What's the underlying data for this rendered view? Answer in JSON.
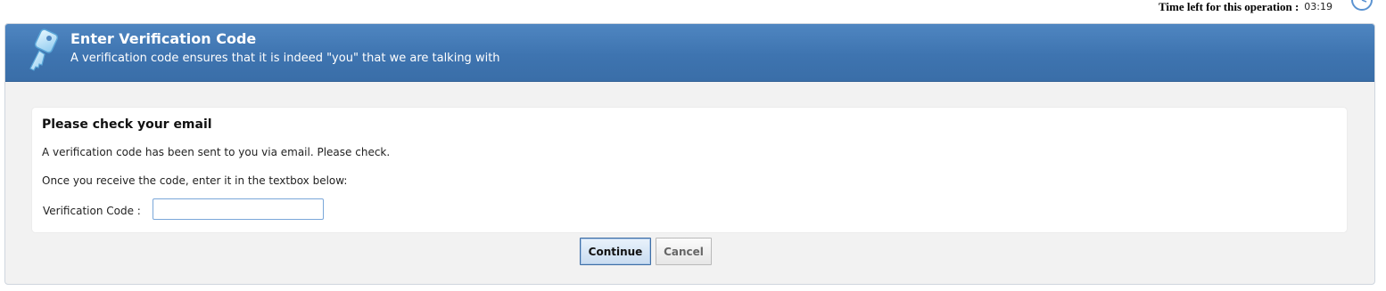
{
  "timer": {
    "label": "Time left for this operation :",
    "value": "03:19",
    "icon": "clock-icon"
  },
  "banner": {
    "icon": "key-icon",
    "title": "Enter Verification Code",
    "subtitle": "A verification code ensures that it is indeed \"you\" that we are talking with"
  },
  "panel": {
    "heading": "Please check your email",
    "line1": "A verification code has been sent to you via email. Please check.",
    "line2": "Once you receive the code, enter it in the textbox below:",
    "code_label": "Verification Code :",
    "code_value": ""
  },
  "buttons": {
    "continue_label": "Continue",
    "cancel_label": "Cancel"
  },
  "colors": {
    "banner": "#3e74b0",
    "panel_bg": "#ffffff",
    "frame_bg": "#f2f2f2"
  }
}
